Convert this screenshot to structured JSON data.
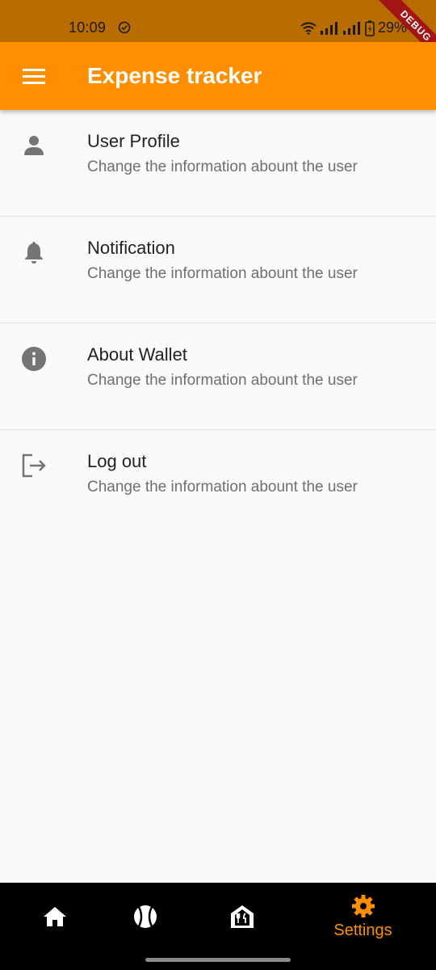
{
  "status_bar": {
    "time": "10:09",
    "battery": "29%"
  },
  "debug_banner": "DEBUG",
  "app_bar": {
    "title": "Expense tracker",
    "menu_icon": "menu-icon"
  },
  "settings": [
    {
      "icon": "person-icon",
      "title": "User Profile",
      "subtitle": "Change the information abount the user"
    },
    {
      "icon": "bell-icon",
      "title": "Notification",
      "subtitle": "Change the information abount the user"
    },
    {
      "icon": "info-icon",
      "title": "About Wallet",
      "subtitle": "Change the information abount the user"
    },
    {
      "icon": "logout-icon",
      "title": "Log out",
      "subtitle": "Change the information abount the user"
    }
  ],
  "bottom_nav": {
    "items": [
      {
        "icon": "home-icon",
        "label": ""
      },
      {
        "icon": "ball-icon",
        "label": ""
      },
      {
        "icon": "restaurant-icon",
        "label": ""
      },
      {
        "icon": "gear-icon",
        "label": "Settings",
        "active": true
      }
    ]
  },
  "colors": {
    "accent": "#ff8f00",
    "status_bar": "#b96d00",
    "icon_grey": "#757575",
    "nav_background": "#000000"
  }
}
